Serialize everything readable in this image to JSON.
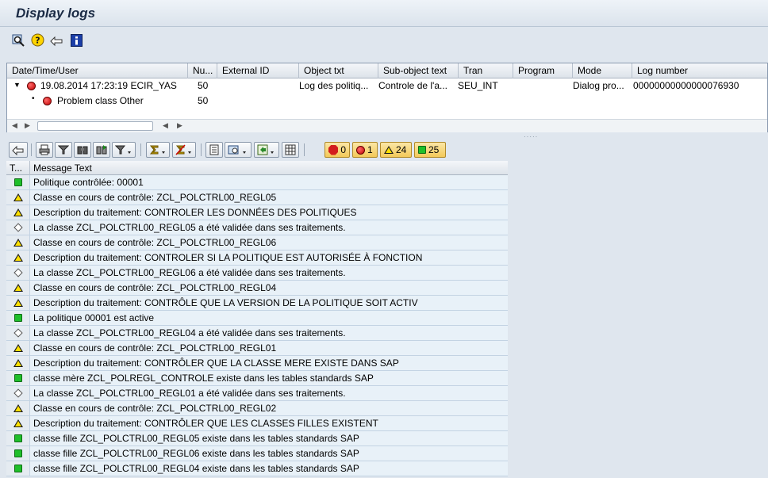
{
  "window": {
    "title": "Display logs"
  },
  "toolbar_icons": [
    "find-icon",
    "help-icon",
    "back-icon",
    "info-icon"
  ],
  "tree": {
    "headers": [
      "Date/Time/User",
      "Nu...",
      "External ID",
      "Object txt",
      "Sub-object text",
      "Tran",
      "Program",
      "Mode",
      "Log number"
    ],
    "rows": [
      {
        "datetime": "19.08.2014  17:23:19  ECIR_YAS",
        "number": "50",
        "external_id": "",
        "object_txt": "Log des politiq...",
        "subobject_txt": "Controle de l'a...",
        "tran": "SEU_INT",
        "program": "",
        "mode": "Dialog pro...",
        "log_number": "00000000000000076930"
      },
      {
        "datetime": "Problem class Other",
        "number": "50"
      }
    ]
  },
  "message_toolbar": {
    "counts": {
      "stop": "0",
      "error": "1",
      "warning": "24",
      "success": "25"
    }
  },
  "messages": {
    "headers": [
      "T...",
      "Message Text"
    ],
    "rows": [
      {
        "type": "success",
        "text": "Politique contrôlée: 00001"
      },
      {
        "type": "warning",
        "text": "Classe en cours de contrôle: ZCL_POLCTRL00_REGL05"
      },
      {
        "type": "warning",
        "text": "Description du traitement: CONTROLER LES DONNÉES DES POLITIQUES"
      },
      {
        "type": "info",
        "text": "La classe ZCL_POLCTRL00_REGL05 a été validée dans ses traitements."
      },
      {
        "type": "warning",
        "text": "Classe en cours de contrôle: ZCL_POLCTRL00_REGL06"
      },
      {
        "type": "warning",
        "text": "Description du traitement: CONTROLER SI LA POLITIQUE EST AUTORISÉE À FONCTION"
      },
      {
        "type": "info",
        "text": "La classe ZCL_POLCTRL00_REGL06 a été validée dans ses traitements."
      },
      {
        "type": "warning",
        "text": "Classe en cours de contrôle: ZCL_POLCTRL00_REGL04"
      },
      {
        "type": "warning",
        "text": "Description du traitement: CONTRÔLE QUE LA VERSION DE LA POLITIQUE SOIT ACTIV"
      },
      {
        "type": "success",
        "text": "La politique 00001 est active"
      },
      {
        "type": "info",
        "text": "La classe ZCL_POLCTRL00_REGL04 a été validée dans ses traitements."
      },
      {
        "type": "warning",
        "text": "Classe en cours de contrôle: ZCL_POLCTRL00_REGL01"
      },
      {
        "type": "warning",
        "text": "Description du traitement: CONTRÔLER QUE LA CLASSE MERE EXISTE DANS SAP"
      },
      {
        "type": "success",
        "text": "classe mère ZCL_POLREGL_CONTROLE existe dans les tables standards SAP"
      },
      {
        "type": "info",
        "text": "La classe ZCL_POLCTRL00_REGL01 a été validée dans ses traitements."
      },
      {
        "type": "warning",
        "text": "Classe en cours de contrôle: ZCL_POLCTRL00_REGL02"
      },
      {
        "type": "warning",
        "text": "Description du traitement: CONTRÔLER QUE LES CLASSES FILLES EXISTENT"
      },
      {
        "type": "success",
        "text": "classe fille ZCL_POLCTRL00_REGL05 existe dans les tables standards SAP"
      },
      {
        "type": "success",
        "text": "classe fille ZCL_POLCTRL00_REGL06 existe dans les tables standards SAP"
      },
      {
        "type": "success",
        "text": "classe fille ZCL_POLCTRL00_REGL04 existe dans les tables standards SAP"
      }
    ]
  }
}
